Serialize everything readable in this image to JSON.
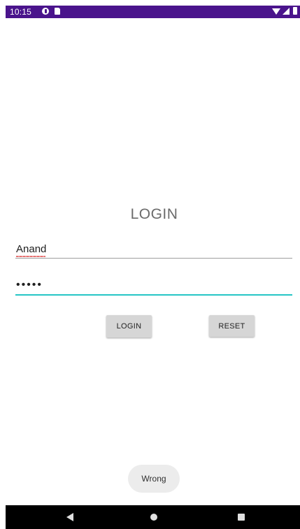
{
  "status_bar": {
    "time": "10:15",
    "background_color": "#4a148c",
    "left_icons": [
      "app-notification-icon",
      "sd-card-icon"
    ],
    "right_icons": [
      "wifi-icon",
      "cell-signal-icon",
      "battery-icon"
    ]
  },
  "screen": {
    "title": "LOGIN"
  },
  "form": {
    "username_value": "Anand",
    "password_masked": "•••••",
    "password_underline_color": "#26c6c6"
  },
  "buttons": {
    "login_label": "LOGIN",
    "reset_label": "RESET"
  },
  "toast": {
    "message": "Wrong"
  },
  "nav_bar": {
    "icons": [
      "back-icon",
      "home-icon",
      "recents-icon"
    ]
  }
}
